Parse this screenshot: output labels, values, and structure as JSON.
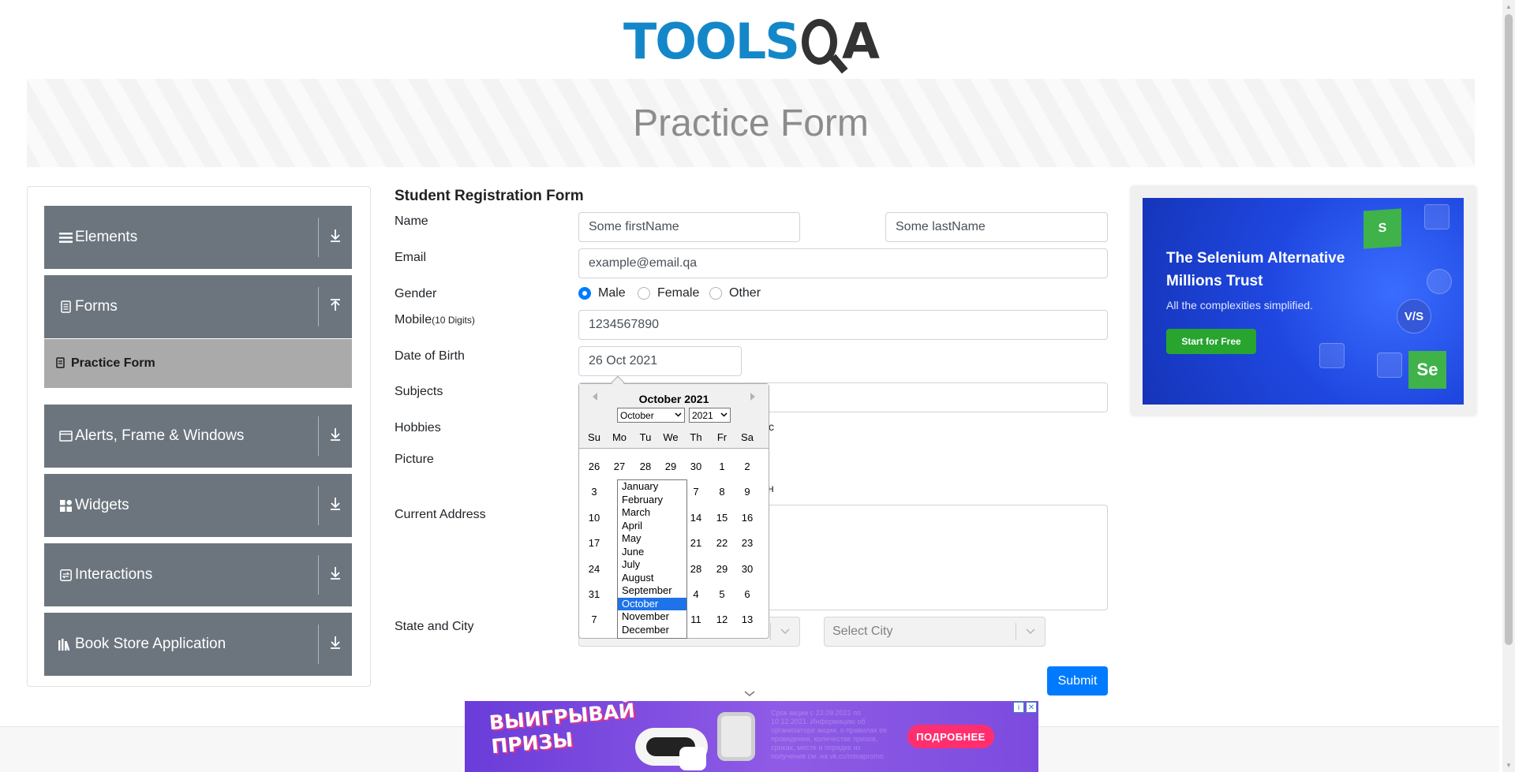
{
  "header": {
    "logo_text": "TOOLS",
    "logo_text_end": "A",
    "page_title": "Practice Form"
  },
  "sidebar": {
    "groups": [
      {
        "label": "Elements",
        "icon": "hamburger-icon"
      },
      {
        "label": "Forms",
        "icon": "document-icon"
      },
      {
        "label": "Alerts, Frame & Windows",
        "icon": "window-icon"
      },
      {
        "label": "Widgets",
        "icon": "grid-icon"
      },
      {
        "label": "Interactions",
        "icon": "interaction-icon"
      },
      {
        "label": "Book Store Application",
        "icon": "books-icon"
      }
    ],
    "active_item": "Practice Form"
  },
  "form": {
    "title": "Student Registration Form",
    "labels": {
      "name": "Name",
      "email": "Email",
      "gender": "Gender",
      "mobile": "Mobile",
      "mobile_hint": "(10 Digits)",
      "dob": "Date of Birth",
      "subjects": "Subjects",
      "hobbies": "Hobbies",
      "picture": "Picture",
      "address": "Current Address",
      "state_city": "State and City"
    },
    "first_name": "Some firstName",
    "last_name": "Some lastName",
    "email": "example@email.qa",
    "gender_options": [
      "Male",
      "Female",
      "Other"
    ],
    "gender_selected": "Male",
    "mobile": "1234567890",
    "dob": "26 Oct 2021",
    "hobbies_fragment": "c",
    "picture_fragment": "н",
    "city_placeholder": "Select City",
    "submit_label": "Submit"
  },
  "datepicker": {
    "title": "October 2021",
    "month_select": "October",
    "year_select": "2021",
    "day_names": [
      "Su",
      "Mo",
      "Tu",
      "We",
      "Th",
      "Fr",
      "Sa"
    ],
    "weeks": [
      [
        "26",
        "27",
        "28",
        "29",
        "30",
        "1",
        "2"
      ],
      [
        "3",
        "",
        "",
        "",
        "7",
        "8",
        "9"
      ],
      [
        "10",
        "",
        "",
        "",
        "14",
        "15",
        "16"
      ],
      [
        "17",
        "",
        "",
        "",
        "21",
        "22",
        "23"
      ],
      [
        "24",
        "",
        "",
        "",
        "28",
        "29",
        "30"
      ],
      [
        "31",
        "",
        "",
        "",
        "4",
        "5",
        "6"
      ],
      [
        "7",
        "",
        "",
        "",
        "11",
        "12",
        "13"
      ]
    ],
    "months": [
      "January",
      "February",
      "March",
      "April",
      "May",
      "June",
      "July",
      "August",
      "September",
      "October",
      "November",
      "December"
    ],
    "selected_month": "October"
  },
  "ads": {
    "right": {
      "headline": "The Selenium Alternative Millions Trust",
      "subline": "All the complexities simplified.",
      "cta": "Start for Free",
      "badge_top": "S",
      "badge_bottom": "Se",
      "vs": "V/S"
    },
    "bottom": {
      "title": "ВЫИГРЫВАЙ ПРИЗЫ",
      "cta": "ПОДРОБНЕЕ",
      "fine_print": "Срок акции с 23.09.2021 по 10.12.2021. Информацию об организаторе акции, о правилах ее проведения, количестве призов, сроках, месте и порядке их получения см. на vk.cc/mtsapromo"
    }
  },
  "colors": {
    "brand_blue": "#1487c9",
    "sidebar_group": "#6c757d",
    "sidebar_active": "#aaaaaa",
    "primary": "#007bff"
  }
}
